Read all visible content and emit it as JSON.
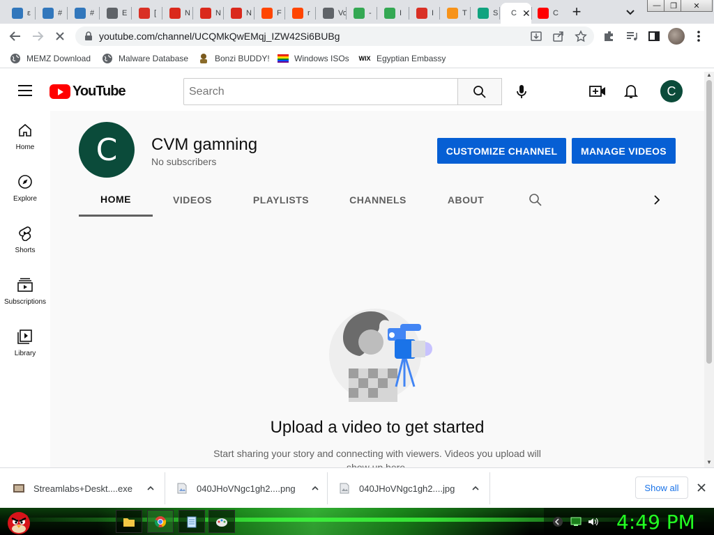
{
  "browser": {
    "tabs": [
      {
        "title": "ε",
        "icon": "edge-icon",
        "color": "#3277bc"
      },
      {
        "title": "#",
        "icon": "edge-icon",
        "color": "#3277bc"
      },
      {
        "title": "#",
        "icon": "edge-icon",
        "color": "#3277bc"
      },
      {
        "title": "E",
        "icon": "globe-icon",
        "color": "#5f6368"
      },
      {
        "title": "[",
        "icon": "gmail-icon",
        "color": "#d93025"
      },
      {
        "title": "N",
        "icon": "mcdonalds-icon",
        "color": "#da291c"
      },
      {
        "title": "N",
        "icon": "mcdonalds-icon",
        "color": "#da291c"
      },
      {
        "title": "N",
        "icon": "mcdonalds-icon",
        "color": "#da291c"
      },
      {
        "title": "F",
        "icon": "reddit-icon",
        "color": "#ff4500"
      },
      {
        "title": "r",
        "icon": "reddit-icon",
        "color": "#ff4500"
      },
      {
        "title": "Vo",
        "icon": "speaker-icon",
        "color": "#5f6368"
      },
      {
        "title": "-",
        "icon": "app-icon",
        "color": "#34a853"
      },
      {
        "title": "I",
        "icon": "app-icon",
        "color": "#34a853"
      },
      {
        "title": "I",
        "icon": "gmail-icon",
        "color": "#d93025"
      },
      {
        "title": "T",
        "icon": "bitcoin-icon",
        "color": "#f7931a"
      },
      {
        "title": "S",
        "icon": "robot-icon",
        "color": "#10a37f"
      },
      {
        "title": "C",
        "icon": "active",
        "color": "#5f6368"
      },
      {
        "title": "C",
        "icon": "youtube-icon",
        "color": "#ff0000"
      }
    ],
    "url": "youtube.com/channel/UCQMkQwEMqj_IZW42Si6BUBg",
    "bookmarks": [
      {
        "label": "MEMZ Download"
      },
      {
        "label": "Malware Database"
      },
      {
        "label": "Bonzi BUDDY!"
      },
      {
        "label": "Windows ISOs"
      },
      {
        "label": "Egyptian Embassy"
      }
    ]
  },
  "youtube": {
    "logo": "YouTube",
    "search_placeholder": "Search",
    "user_initial": "C",
    "guide": [
      {
        "label": "Home"
      },
      {
        "label": "Explore"
      },
      {
        "label": "Shorts"
      },
      {
        "label": "Subscriptions"
      },
      {
        "label": "Library"
      }
    ],
    "channel": {
      "initial": "C",
      "name": "CVM gamning",
      "subscribers": "No subscribers",
      "customize_label": "CUSTOMIZE CHANNEL",
      "manage_label": "MANAGE VIDEOS",
      "tabs": [
        "HOME",
        "VIDEOS",
        "PLAYLISTS",
        "CHANNELS",
        "ABOUT"
      ]
    },
    "empty": {
      "title": "Upload a video to get started",
      "description": "Start sharing your story and connecting with viewers. Videos you upload will show up here."
    }
  },
  "downloads": {
    "items": [
      {
        "name": "Streamlabs+Deskt....exe"
      },
      {
        "name": "040JHoVNgc1gh2....png"
      },
      {
        "name": "040JHoVNgc1gh2....jpg"
      }
    ],
    "show_all": "Show all"
  },
  "taskbar": {
    "clock": "4:49 PM"
  }
}
